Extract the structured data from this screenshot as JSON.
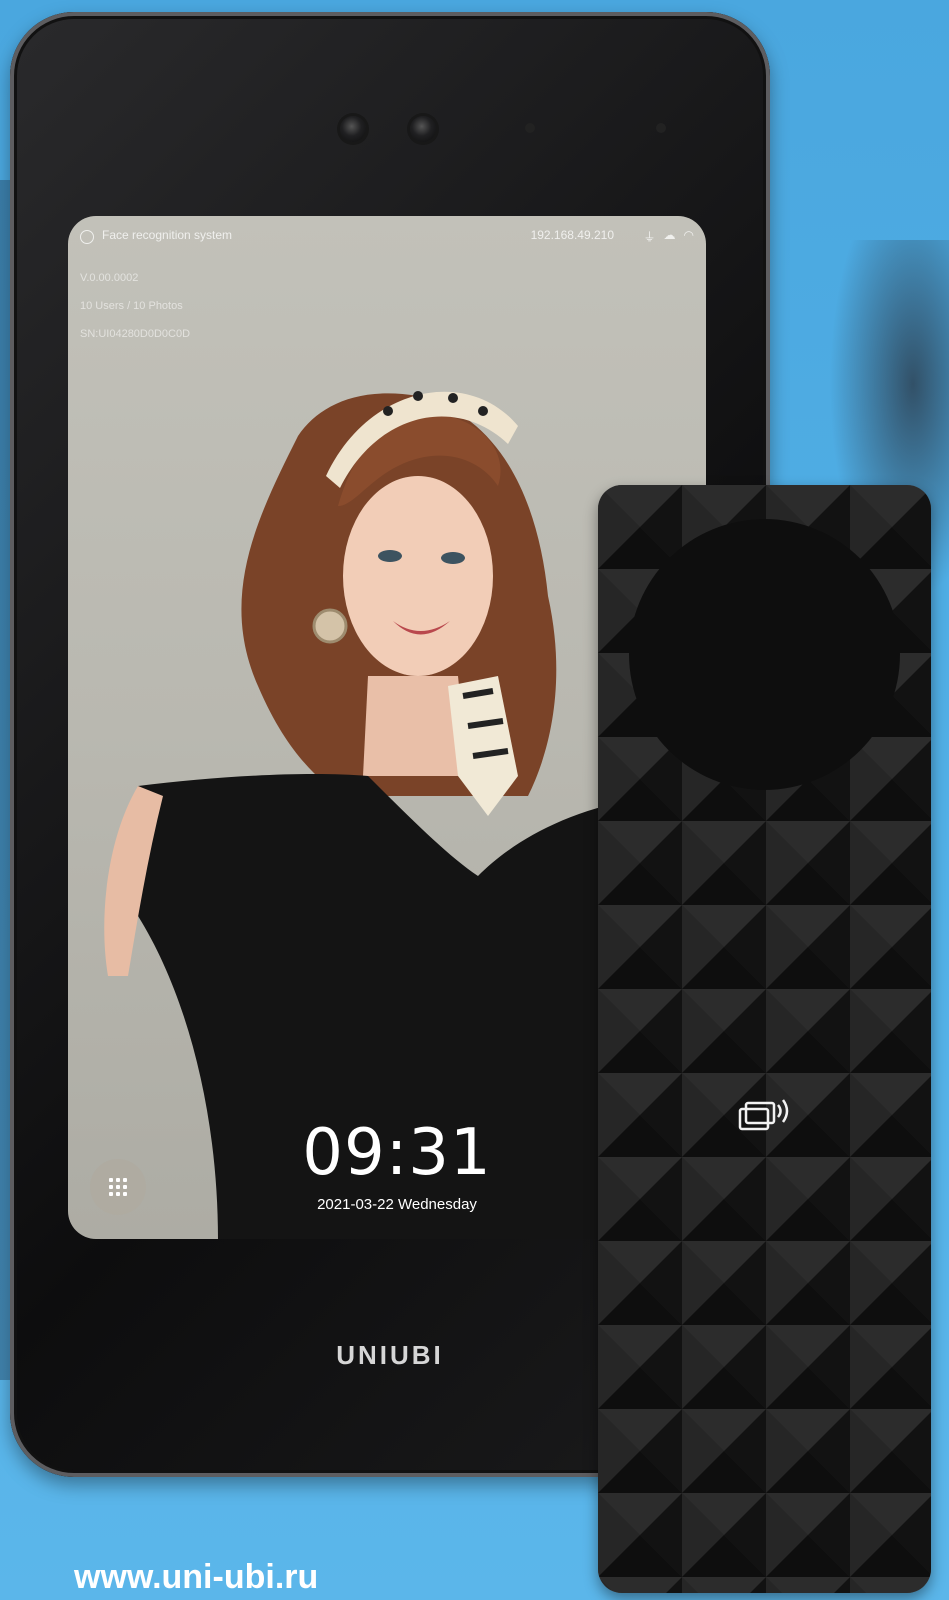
{
  "screen_status": {
    "title": "Face recognition system",
    "ip": "192.168.49.210"
  },
  "screen_info": [
    "V.0.00.0002",
    "10 Users / 10 Photos",
    "SN:UI04280D0D0C0D"
  ],
  "clock": {
    "time": "09:31",
    "date": "2021-03-22  Wednesday"
  },
  "brand": "UNIUBI",
  "website": "www.uni-ubi.ru",
  "icons": [
    "usb-icon",
    "cloud-icon",
    "wifi-icon",
    "apps-grid-icon",
    "nfc-card-icon"
  ],
  "colors": {
    "background": "#52b0e6",
    "device_body": "#111111",
    "screen_bg": "#bdbcb4",
    "ring": "#e6e6e9"
  }
}
